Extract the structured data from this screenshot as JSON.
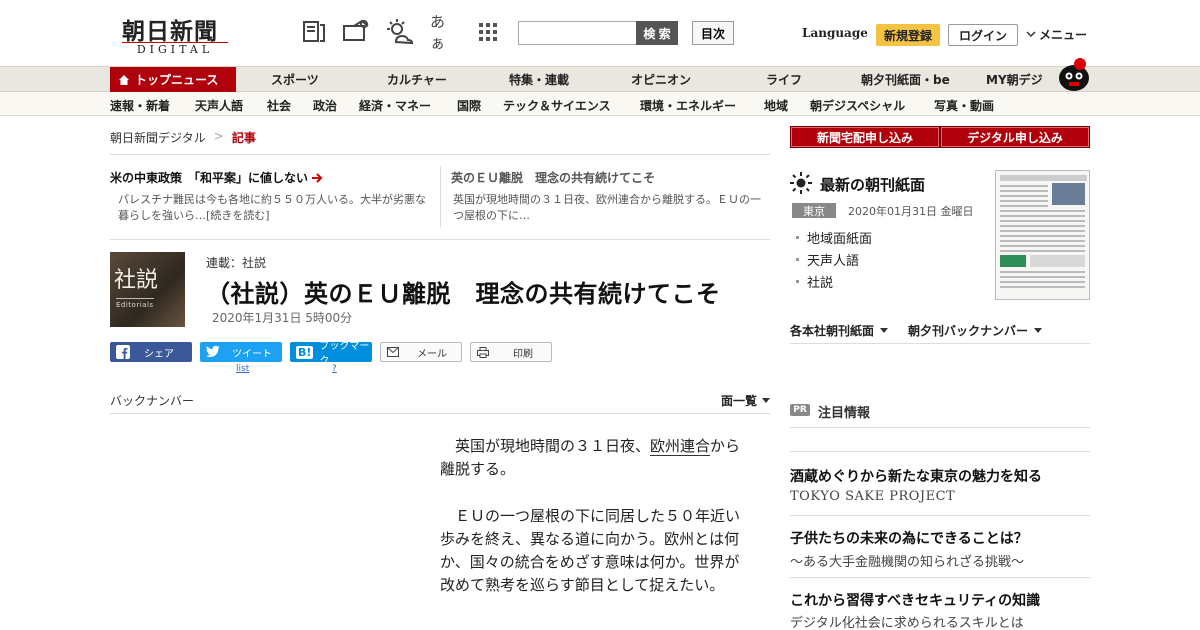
{
  "header": {
    "logo_main": "朝日新聞",
    "logo_sub": "DIGITAL",
    "icons": [
      "news-icon",
      "ticket-icon",
      "weather-icon",
      "font-size-icon",
      "apps-icon"
    ],
    "font_icon_text": "あぁ",
    "search_placeholder": "",
    "search_button": "検 索",
    "toc_button": "目次",
    "language": "Language",
    "signup": "新規登録",
    "login": "ログイン",
    "menu": "メニュー"
  },
  "nav_primary": [
    "トップニュース",
    "スポーツ",
    "カルチャー",
    "特集・連載",
    "オピニオン",
    "ライフ",
    "朝夕刊紙面・be",
    "MY朝デジ"
  ],
  "nav_secondary": [
    "速報・新着",
    "天声人語",
    "社会",
    "政治",
    "経済・マネー",
    "国際",
    "テック＆サイエンス",
    "環境・エネルギー",
    "地域",
    "朝デジスペシャル",
    "写真・動画"
  ],
  "breadcrumb": {
    "home": "朝日新聞デジタル",
    "sep": ">",
    "current": "記事"
  },
  "related": [
    {
      "title": "米の中東政策　「和平案」に値しない",
      "text": "パレスチナ難民は今も各地に約５５０万人いる。大半が劣悪な暮らしを強いら…[続きを読む]"
    },
    {
      "title": "英のＥＵ離脱　理念の共有続けてこそ",
      "text": "英国が現地時間の３１日夜、欧州連合から離脱する。ＥＵの一つ屋根の下に…"
    }
  ],
  "article": {
    "thumb_big": "社説",
    "thumb_small": "Editorials",
    "series": "連載：社説",
    "headline": "（社説）英のＥＵ離脱　理念の共有続けてこそ",
    "date": "2020年1月31日 5時00分",
    "share": {
      "facebook": "シェア",
      "twitter": "ツイート",
      "twitter_sub": "list",
      "hatena": "ブックマーク",
      "hatena_sub": "?",
      "mail": "メール",
      "print": "印刷"
    },
    "backnumber": "バックナンバー",
    "page_list": "面一覧",
    "paragraphs": [
      {
        "before": "英国が現地時間の３１日夜、",
        "link": "欧州連合",
        "after": "から離脱する。"
      },
      {
        "before": "ＥＵの一つ屋根の下に同居した５０年近い歩みを終え、異なる道に向かう。欧州とは何か、国々の統合をめざす意味は何か。世界が改めて熟考を巡らす節目として捉えたい。",
        "link": "",
        "after": ""
      }
    ]
  },
  "sidebar": {
    "order_paper": "新聞宅配申し込み",
    "order_digital": "デジタル申し込み",
    "paper_title": "最新の朝刊紙面",
    "region": "東京",
    "paper_date": "2020年01月31日 金曜日",
    "paper_links": [
      "地域面紙面",
      "天声人語",
      "社説"
    ],
    "dropdown_1": "各本社朝刊紙面",
    "dropdown_2": "朝夕刊バックナンバー",
    "pr_badge": "PR",
    "pr_title": "注目情報",
    "ads": [
      {
        "title": "酒蔵めぐりから新たな東京の魅力を知る",
        "sub": "TOKYO SAKE PROJECT"
      },
      {
        "title": "子供たちの未来の為にできることは？",
        "sub": "～ある大手金融機関の知られざる挑戦～"
      },
      {
        "title": "これから習得すべきセキュリティの知識",
        "sub": "デジタル化社会に求められるスキルとは"
      }
    ]
  },
  "colors": {
    "brand_red": "#b0000b",
    "signup_yellow": "#f5c342",
    "nav_bg": "#e9e7df"
  }
}
